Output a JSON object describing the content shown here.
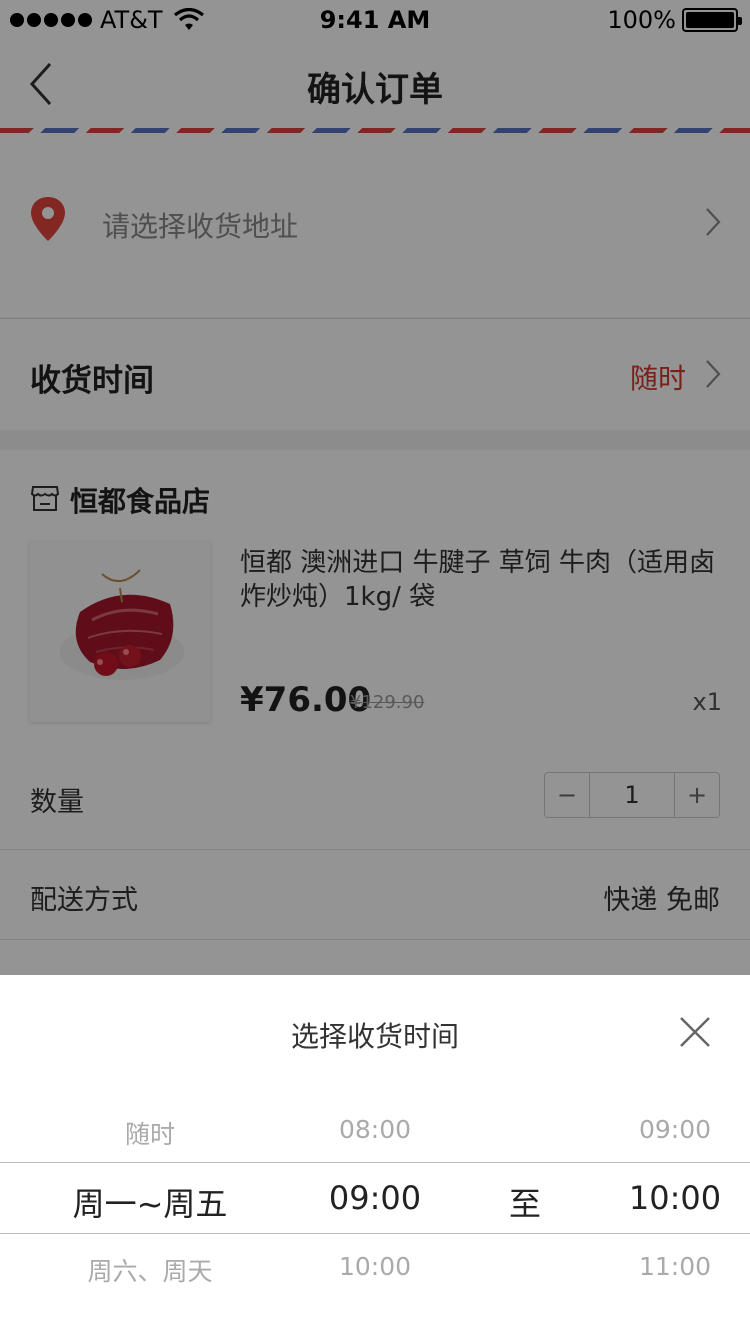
{
  "status_bar": {
    "carrier": "AT&T",
    "time": "9:41 AM",
    "battery": "100%"
  },
  "nav": {
    "title": "确认订单"
  },
  "address": {
    "placeholder": "请选择收货地址"
  },
  "delivery_time": {
    "label": "收货时间",
    "value": "随时"
  },
  "shop": {
    "name": "恒都食品店",
    "product": {
      "title": "恒都 澳洲进口 牛腱子 草饲 牛肉（适用卤炸炒炖）1kg/ 袋",
      "price": "¥76.00",
      "original_price": "¥129.90",
      "quantity_label": "x1"
    },
    "quantity": {
      "label": "数量",
      "value": "1",
      "minus": "−",
      "plus": "+"
    },
    "shipping": {
      "label": "配送方式",
      "value": "快递 免邮"
    }
  },
  "sheet": {
    "title": "选择收货时间",
    "columns": {
      "day": [
        "随时",
        "周一~周五",
        "周六、周天"
      ],
      "start": [
        "08:00",
        "09:00",
        "10:00"
      ],
      "separator": "至",
      "end": [
        "09:00",
        "10:00",
        "11:00"
      ]
    }
  },
  "colors": {
    "accent": "#d0392b",
    "pin": "#e0443a",
    "airmail_red": "#d7463b",
    "airmail_blue": "#5a73c4"
  },
  "icons": [
    "back-icon",
    "location-pin-icon",
    "chevron-right-icon",
    "store-icon",
    "close-icon",
    "wifi-icon",
    "battery-icon"
  ]
}
